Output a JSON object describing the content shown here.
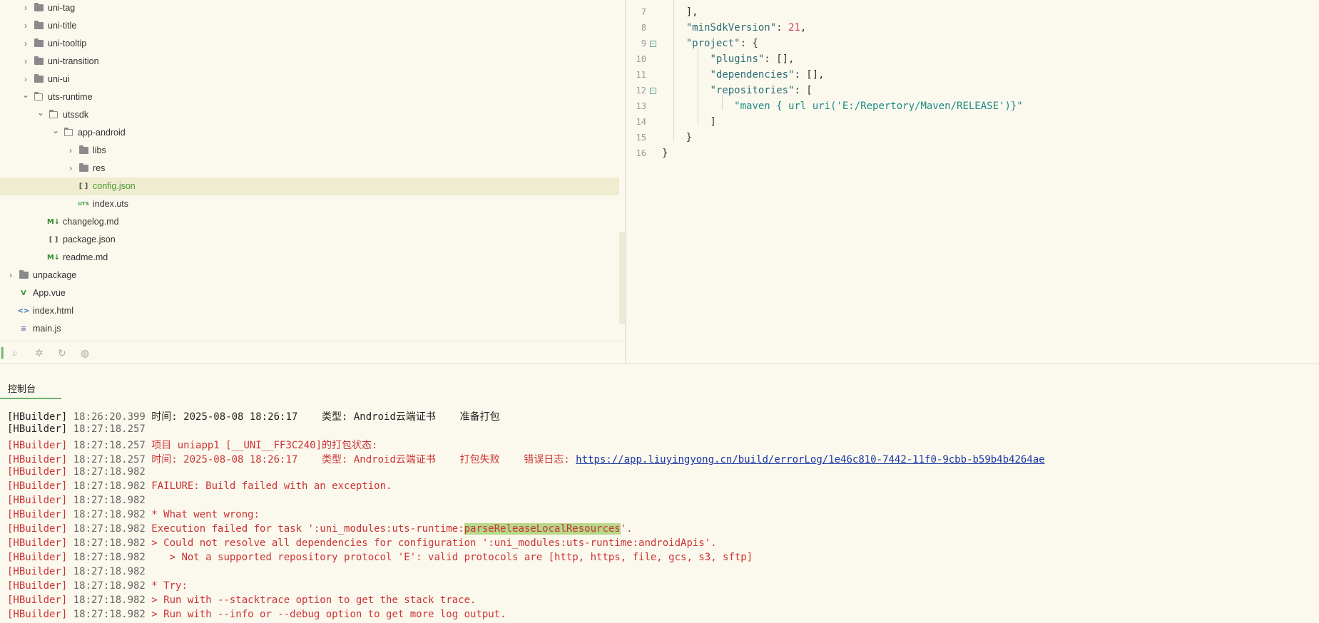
{
  "file_tree": {
    "items": [
      {
        "label": "uni-tag",
        "depth": 1,
        "kind": "folder",
        "expanded": false
      },
      {
        "label": "uni-title",
        "depth": 1,
        "kind": "folder",
        "expanded": false
      },
      {
        "label": "uni-tooltip",
        "depth": 1,
        "kind": "folder",
        "expanded": false
      },
      {
        "label": "uni-transition",
        "depth": 1,
        "kind": "folder",
        "expanded": false
      },
      {
        "label": "uni-ui",
        "depth": 1,
        "kind": "folder",
        "expanded": false
      },
      {
        "label": "uts-runtime",
        "depth": 1,
        "kind": "folder",
        "expanded": true
      },
      {
        "label": "utssdk",
        "depth": 2,
        "kind": "folder",
        "expanded": true
      },
      {
        "label": "app-android",
        "depth": 3,
        "kind": "folder",
        "expanded": true
      },
      {
        "label": "libs",
        "depth": 4,
        "kind": "folder",
        "expanded": false
      },
      {
        "label": "res",
        "depth": 4,
        "kind": "folder",
        "expanded": false
      },
      {
        "label": "config.json",
        "depth": 4,
        "kind": "json",
        "selected": true
      },
      {
        "label": "index.uts",
        "depth": 4,
        "kind": "uts"
      },
      {
        "label": "changelog.md",
        "depth": 2,
        "kind": "md"
      },
      {
        "label": "package.json",
        "depth": 2,
        "kind": "json"
      },
      {
        "label": "readme.md",
        "depth": 2,
        "kind": "md"
      },
      {
        "label": "unpackage",
        "depth": 0,
        "kind": "folder",
        "expanded": false
      },
      {
        "label": "App.vue",
        "depth": 0,
        "kind": "vue"
      },
      {
        "label": "index.html",
        "depth": 0,
        "kind": "html"
      },
      {
        "label": "main.js",
        "depth": 0,
        "kind": "js"
      }
    ],
    "file_icon_text": {
      "json": "[ ]",
      "uts": "UTS",
      "md": "M↓",
      "vue": "V",
      "html": "<>",
      "js": "≡"
    }
  },
  "editor": {
    "lines": [
      {
        "num": "7",
        "tokens": [
          {
            "t": "    ],",
            "c": "p"
          }
        ]
      },
      {
        "num": "8",
        "tokens": [
          {
            "t": "    ",
            "c": "p"
          },
          {
            "t": "\"minSdkVersion\"",
            "c": "k"
          },
          {
            "t": ": ",
            "c": "p"
          },
          {
            "t": "21",
            "c": "n"
          },
          {
            "t": ",",
            "c": "p"
          }
        ]
      },
      {
        "num": "9",
        "fold": true,
        "tokens": [
          {
            "t": "    ",
            "c": "p"
          },
          {
            "t": "\"project\"",
            "c": "k"
          },
          {
            "t": ": {",
            "c": "p"
          }
        ]
      },
      {
        "num": "10",
        "tokens": [
          {
            "t": "        ",
            "c": "p"
          },
          {
            "t": "\"plugins\"",
            "c": "k"
          },
          {
            "t": ": [],",
            "c": "p"
          }
        ]
      },
      {
        "num": "11",
        "tokens": [
          {
            "t": "        ",
            "c": "p"
          },
          {
            "t": "\"dependencies\"",
            "c": "k"
          },
          {
            "t": ": [],",
            "c": "p"
          }
        ]
      },
      {
        "num": "12",
        "fold": true,
        "tokens": [
          {
            "t": "        ",
            "c": "p"
          },
          {
            "t": "\"repositories\"",
            "c": "k"
          },
          {
            "t": ": [",
            "c": "p"
          }
        ]
      },
      {
        "num": "13",
        "tokens": [
          {
            "t": "            ",
            "c": "p"
          },
          {
            "t": "\"maven { url uri('E:/Repertory/Maven/RELEASE')}\"",
            "c": "s"
          }
        ]
      },
      {
        "num": "14",
        "tokens": [
          {
            "t": "        ]",
            "c": "p"
          }
        ]
      },
      {
        "num": "15",
        "tokens": [
          {
            "t": "    }",
            "c": "p"
          }
        ]
      },
      {
        "num": "16",
        "tokens": [
          {
            "t": "}",
            "c": "p"
          }
        ]
      }
    ]
  },
  "console": {
    "tab_label": "控制台",
    "lines": [
      {
        "tag": "[HBuilder]",
        "ts": "18:26:20.399",
        "msg": "时间: 2025-08-08 18:26:17    类型: Android云端证书    准备打包",
        "ok": true
      },
      {
        "tag": "[HBuilder]",
        "ts": "18:27:18.257",
        "msg": "",
        "ok": true
      },
      {
        "tag": "[HBuilder]",
        "ts": "18:27:18.257",
        "msg": "项目 uniapp1 [__UNI__FF3C240]的打包状态:"
      },
      {
        "tag": "[HBuilder]",
        "ts": "18:27:18.257",
        "msg": "时间: 2025-08-08 18:26:17    类型: Android云端证书    打包失败    错误日志: ",
        "link": "https://app.liuyingyong.cn/build/errorLog/1e46c810-7442-11f0-9cbb-b59b4b4264ae"
      },
      {
        "tag": "[HBuilder]",
        "ts": "18:27:18.982",
        "msg": ""
      },
      {
        "tag": "[HBuilder]",
        "ts": "18:27:18.982",
        "msg": "FAILURE: Build failed with an exception."
      },
      {
        "tag": "[HBuilder]",
        "ts": "18:27:18.982",
        "msg": ""
      },
      {
        "tag": "[HBuilder]",
        "ts": "18:27:18.982",
        "msg": "* What went wrong:"
      },
      {
        "tag": "[HBuilder]",
        "ts": "18:27:18.982",
        "msg": "Execution failed for task ':uni_modules:uts-runtime:",
        "hl": "parseReleaseLocalResources",
        "tail": "'."
      },
      {
        "tag": "[HBuilder]",
        "ts": "18:27:18.982",
        "msg": "> Could not resolve all dependencies for configuration ':uni_modules:uts-runtime:androidApis'."
      },
      {
        "tag": "[HBuilder]",
        "ts": "18:27:18.982",
        "msg": "   > Not a supported repository protocol 'E': valid protocols are [http, https, file, gcs, s3, sftp]"
      },
      {
        "tag": "[HBuilder]",
        "ts": "18:27:18.982",
        "msg": ""
      },
      {
        "tag": "[HBuilder]",
        "ts": "18:27:18.982",
        "msg": "* Try:"
      },
      {
        "tag": "[HBuilder]",
        "ts": "18:27:18.982",
        "msg": "> Run with --stacktrace option to get the stack trace."
      },
      {
        "tag": "[HBuilder]",
        "ts": "18:27:18.982",
        "msg": "> Run with --info or --debug option to get more log output."
      }
    ]
  },
  "colors": {
    "background": "#fbf9ee",
    "selected_row": "#efecd0",
    "error": "#cc3333",
    "link": "#1a35a3",
    "highlight": "#b5d88a"
  }
}
